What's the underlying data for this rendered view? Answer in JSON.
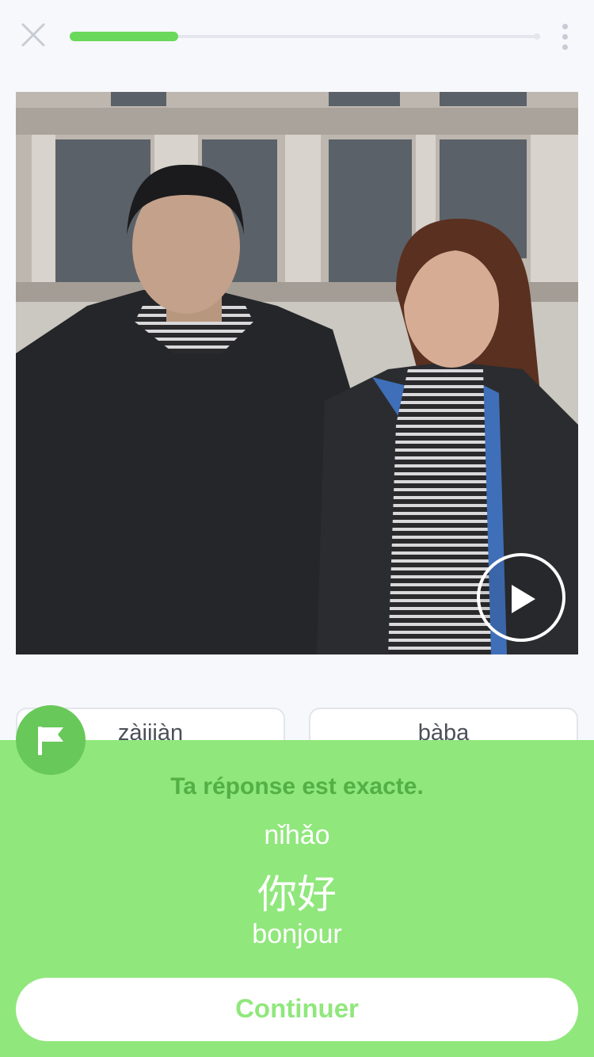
{
  "header": {
    "close_icon": "close-icon",
    "progress": 0.23,
    "menu_icon": "more-vertical-icon"
  },
  "video": {
    "play_icon": "play-icon"
  },
  "choices": [
    {
      "label": "zàijiàn"
    },
    {
      "label": "bàba"
    }
  ],
  "feedback": {
    "flag_icon": "flag-icon",
    "title": "Ta réponse est exacte.",
    "pinyin": "nǐhǎo",
    "hanzi": "你好",
    "translation": "bonjour",
    "continue_label": "Continuer"
  },
  "colors": {
    "accent": "#6ad85a",
    "feedback_bg": "#90e77c",
    "feedback_title": "#52b044",
    "flag_bg": "#68c85a"
  }
}
